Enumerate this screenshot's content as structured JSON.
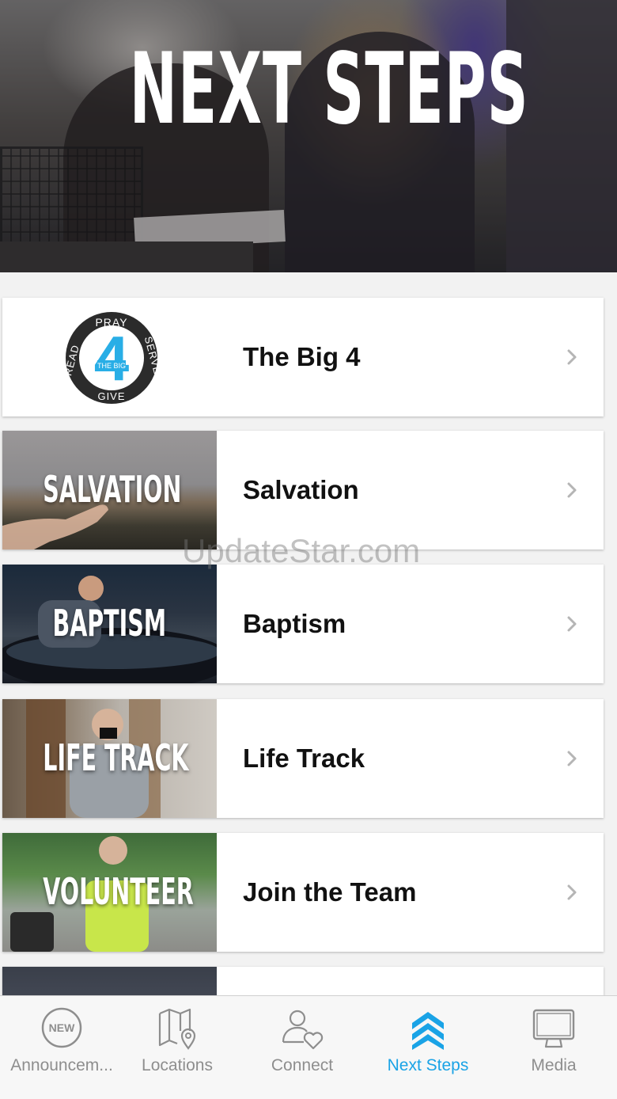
{
  "hero": {
    "title": "NEXT STEPS"
  },
  "items": [
    {
      "label": "The Big 4",
      "logo": {
        "top": "PRAY",
        "right": "SERVE",
        "bottom": "GIVE",
        "left": "READ",
        "number": "4",
        "sub": "THE BIG"
      }
    },
    {
      "label": "Salvation",
      "thumb_title": "SALVATION"
    },
    {
      "label": "Baptism",
      "thumb_title": "BAPTISM"
    },
    {
      "label": "Life Track",
      "thumb_title": "LIFE TRACK"
    },
    {
      "label": "Join the Team",
      "thumb_title": "VOLUNTEER"
    }
  ],
  "watermark": "UpdateStar.com",
  "tabbar": {
    "tabs": [
      {
        "label": "Announcem...",
        "icon": "new-badge-icon",
        "active": false
      },
      {
        "label": "Locations",
        "icon": "map-pin-icon",
        "active": false
      },
      {
        "label": "Connect",
        "icon": "person-heart-icon",
        "active": false
      },
      {
        "label": "Next Steps",
        "icon": "chevrons-up-icon",
        "active": true
      },
      {
        "label": "Media",
        "icon": "monitor-icon",
        "active": false
      }
    ],
    "new_badge_text": "NEW"
  },
  "colors": {
    "accent": "#1aa3e6",
    "inactive": "#8e8e8e",
    "logo_blue": "#29aee6"
  }
}
